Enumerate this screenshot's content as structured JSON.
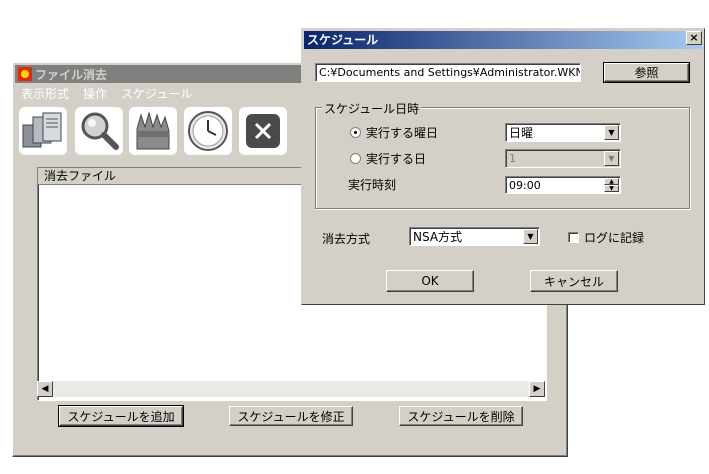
{
  "main_window": {
    "title": "ファイル消去",
    "menu": [
      "表示形式",
      "操作",
      "スケジュール"
    ],
    "toolbar_icons": [
      "files-icon",
      "magnifier-icon",
      "shredder-icon",
      "clock-icon",
      "close-icon"
    ],
    "list_header": "消去ファイル",
    "buttons": {
      "add": "スケジュールを追加",
      "edit": "スケジュールを修正",
      "delete": "スケジュールを削除"
    }
  },
  "dialog": {
    "title": "スケジュール",
    "close_glyph": "×",
    "path_value": "C:¥Documents and Settings¥Administrator.WKNFR",
    "browse_label": "参照",
    "group_label": "スケジュール日時",
    "radio_weekday_label": "実行する曜日",
    "radio_day_label": "実行する日",
    "weekday_value": "日曜",
    "day_value": "1",
    "time_label": "実行時刻",
    "time_value": "09:00",
    "method_label": "消去方式",
    "method_value": "NSA方式",
    "log_label": "ログに記録",
    "ok_label": "OK",
    "cancel_label": "キャンセル"
  },
  "colors": {
    "face": "#d4d0c8",
    "title_active_start": "#0a246a",
    "title_active_end": "#a6caf0",
    "title_inactive": "#808080"
  }
}
